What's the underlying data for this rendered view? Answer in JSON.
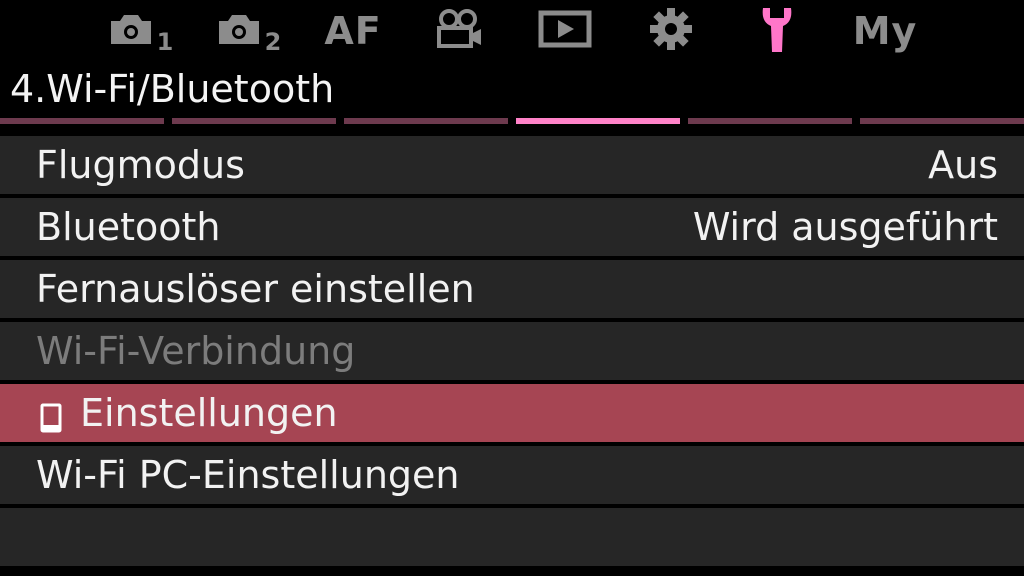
{
  "tabs": [
    {
      "label": "camera-1",
      "icon": "camera-icon",
      "sub": "1",
      "active": false
    },
    {
      "label": "camera-2",
      "icon": "camera-icon",
      "sub": "2",
      "active": false
    },
    {
      "label": "AF",
      "active": false
    },
    {
      "label": "video",
      "icon": "video-camera-icon",
      "active": false
    },
    {
      "label": "playback",
      "icon": "play-icon",
      "active": false
    },
    {
      "label": "custom",
      "icon": "gear-icon",
      "active": false
    },
    {
      "label": "setup",
      "icon": "wrench-icon",
      "active": true
    },
    {
      "label": "My",
      "active": false
    }
  ],
  "tab_labels": {
    "af": "AF",
    "my": "My",
    "sub1": "1",
    "sub2": "2"
  },
  "section_title": "4.Wi-Fi/Bluetooth",
  "pager": {
    "count": 6,
    "active_index": 3
  },
  "menu": {
    "items": [
      {
        "label": "Flugmodus",
        "value": "Aus",
        "disabled": false,
        "selected": false
      },
      {
        "label": "Bluetooth",
        "value": "Wird ausgeführt",
        "disabled": false,
        "selected": false
      },
      {
        "label": "Fernauslöser einstellen",
        "value": "",
        "disabled": false,
        "selected": false
      },
      {
        "label": "Wi-Fi-Verbindung",
        "value": "",
        "disabled": true,
        "selected": false
      },
      {
        "label": "Einstellungen",
        "value": "",
        "icon": "smartphone-icon",
        "disabled": false,
        "selected": true
      },
      {
        "label": "Wi-Fi PC-Einstellungen",
        "value": "",
        "disabled": false,
        "selected": false
      }
    ]
  },
  "colors": {
    "accent": "#ff76c9",
    "selected_row": "#a64553",
    "row_bg": "#262626",
    "disabled_text": "#7c7c7c"
  }
}
